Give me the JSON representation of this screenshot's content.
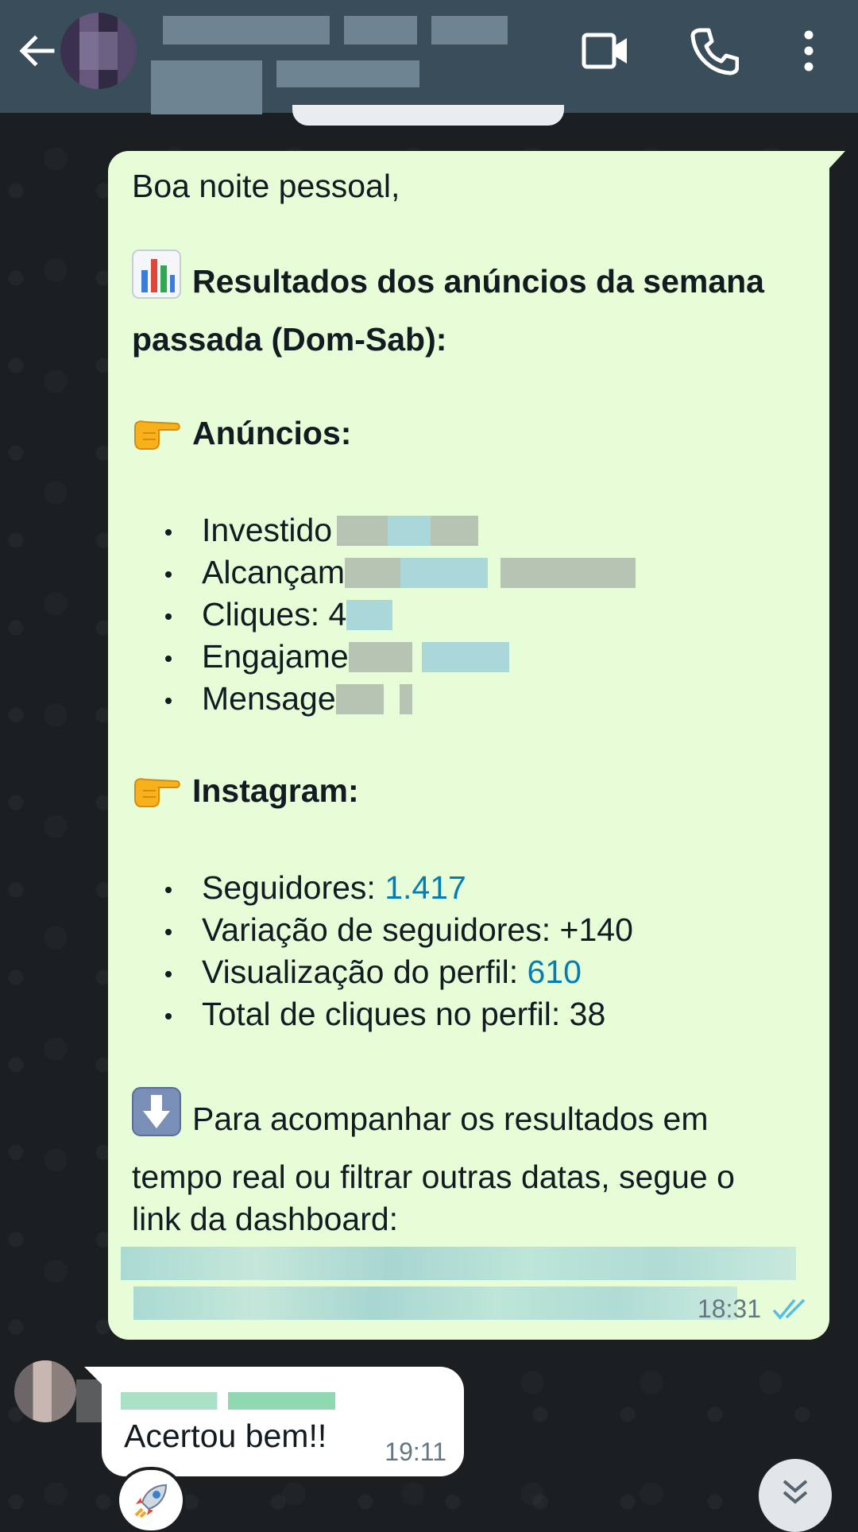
{
  "header": {
    "contact_name": "",
    "contact_status": "",
    "icons": [
      "back-arrow-icon",
      "video-call-icon",
      "phone-icon",
      "more-vert-icon"
    ]
  },
  "outgoing_message": {
    "greeting": "Boa noite pessoal,",
    "heading_line1": "Resultados dos anúncios da semana",
    "heading_line2": "passada (Dom-Sab):",
    "ads_section_title": "Anúncios:",
    "ads_items": [
      "Investido",
      "Alcançam",
      "Cliques: 4",
      "Engajame",
      "Mensage"
    ],
    "instagram_section_title": "Instagram:",
    "instagram_items": [
      {
        "label": "Seguidores: ",
        "value": "1.417"
      },
      {
        "label": "Variação de seguidores: +140",
        "value": ""
      },
      {
        "label": "Visualização do perfil: ",
        "value": "610"
      },
      {
        "label": "Total de cliques no perfil: 38",
        "value": ""
      }
    ],
    "dashboard_line1": "Para acompanhar os resultados em",
    "dashboard_line2": "tempo real ou filtrar outras datas, segue o",
    "dashboard_line3": "link da dashboard:",
    "time": "18:31",
    "status": "read"
  },
  "incoming_message": {
    "sender": "",
    "text": "Acertou bem!!",
    "time": "19:11",
    "reaction": "rocket"
  },
  "colors": {
    "header_bg": "#3a4d5a",
    "outgoing_bg": "#e7fdd8",
    "incoming_bg": "#ffffff",
    "link": "#027eb5",
    "read_ticks": "#53bdeb",
    "chat_bg": "#1b1f22"
  }
}
